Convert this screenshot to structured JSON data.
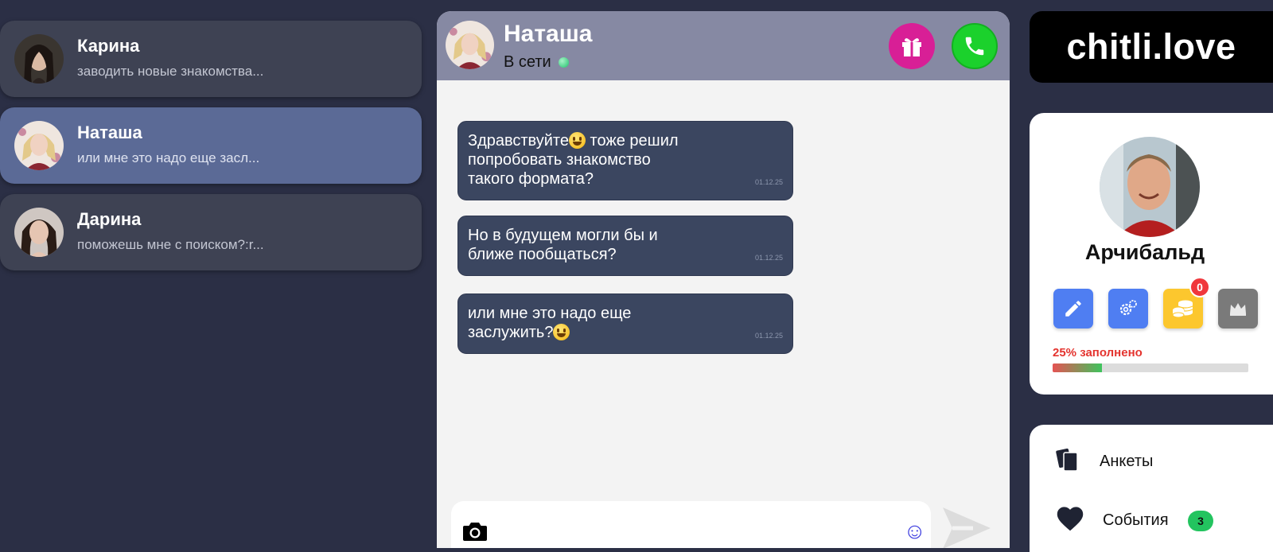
{
  "contacts": [
    {
      "name": "Карина",
      "preview": "заводить новые знакомства..."
    },
    {
      "name": "Наташа",
      "preview": "или мне это надо еще засл..."
    },
    {
      "name": "Дарина",
      "preview": "поможешь мне с поиском?:r..."
    }
  ],
  "chat": {
    "name": "Наташа",
    "status": "В сети",
    "messages": [
      {
        "before": "Здравствуйте",
        "after": " тоже решил\nпопробовать знакомство\nтакого формата?",
        "time": "01.12.25"
      },
      {
        "text": "Но в будущем могли бы и\nближе пообщаться?",
        "time": "01.12.25"
      },
      {
        "text": "или мне это надо еще\nзаслужить?",
        "time": "01.12.25"
      }
    ],
    "input_placeholder": ""
  },
  "brand": "chitli.love",
  "profile": {
    "name": "Арчибальд",
    "coins_badge": "0",
    "completion_label": "25% заполнено",
    "completion": 0.25
  },
  "menu": {
    "items": [
      {
        "label": "Анкеты"
      },
      {
        "label": "События",
        "badge": "3"
      }
    ]
  },
  "colors": {
    "page_bg": "#2b2f45",
    "contact_active": "#5b6a96",
    "gift": "#d81f96",
    "call": "#1bd12c",
    "message_bubble": "#3b4660",
    "badge_red": "#f0373c",
    "count_green": "#23c45f"
  },
  "icons": [
    "gift-icon",
    "phone-icon",
    "camera-icon",
    "emoji-icon",
    "send-icon",
    "pencil-icon",
    "gear-icon",
    "coins-icon",
    "crown-icon",
    "cards-icon",
    "heart-icon"
  ]
}
